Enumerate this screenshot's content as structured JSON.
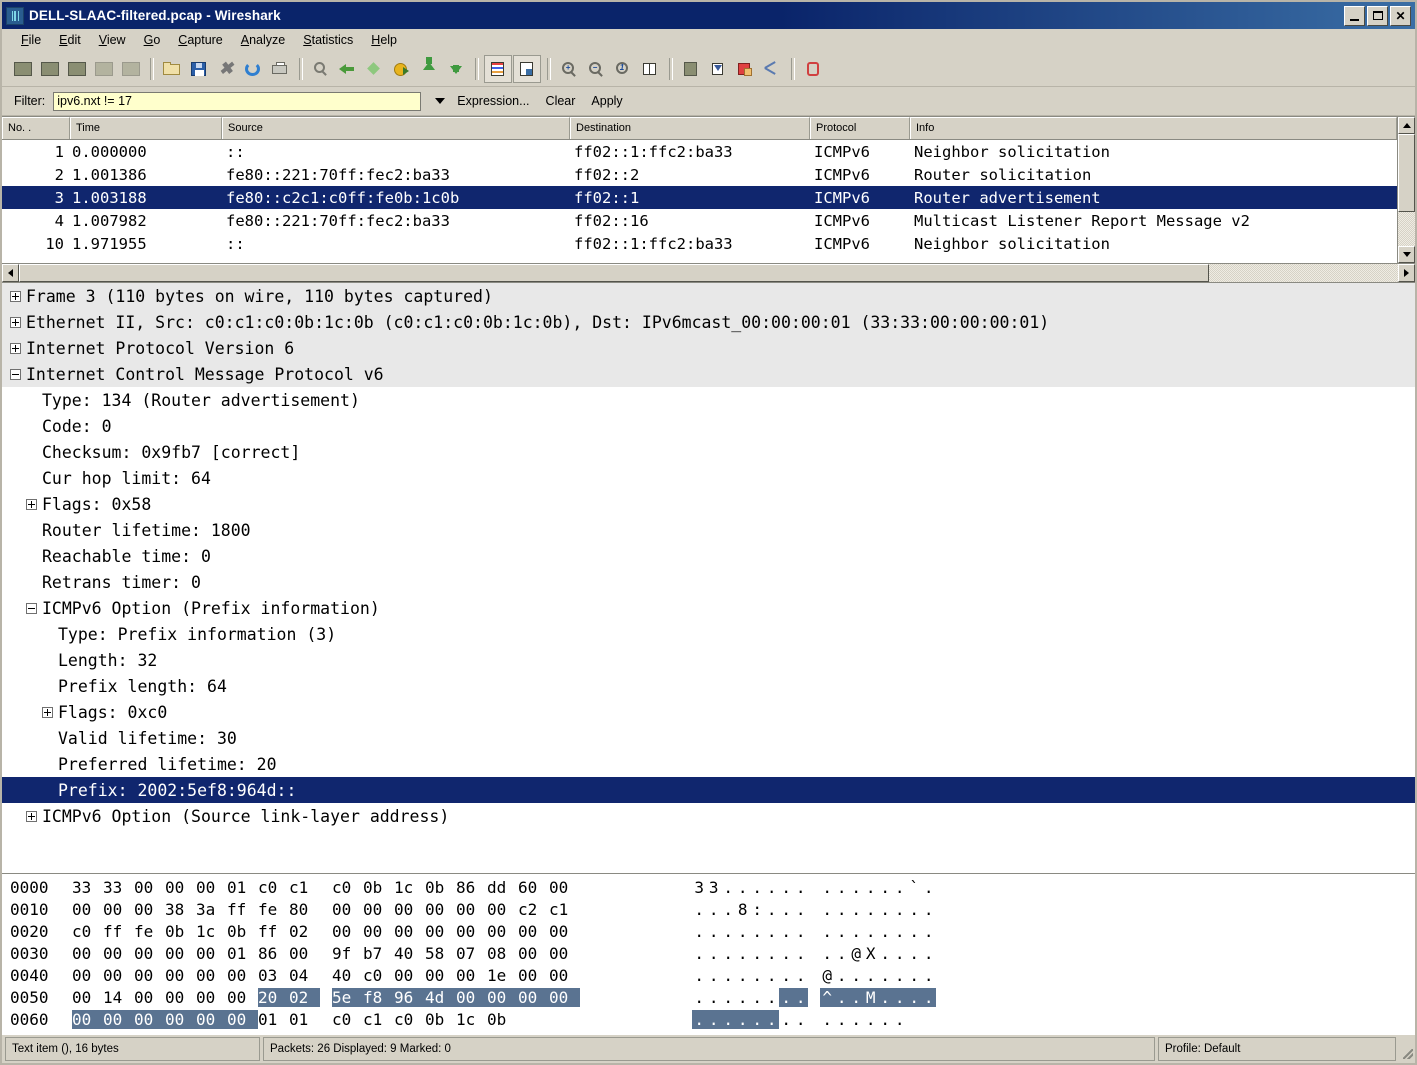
{
  "window": {
    "title": "DELL-SLAAC-filtered.pcap - Wireshark",
    "app_icon": "wireshark-icon",
    "minimize_label": "_",
    "maximize_label": "□",
    "close_label": "✕"
  },
  "menubar": {
    "items": [
      {
        "label": "File",
        "mnemonic": "F"
      },
      {
        "label": "Edit",
        "mnemonic": "E"
      },
      {
        "label": "View",
        "mnemonic": "V"
      },
      {
        "label": "Go",
        "mnemonic": "G"
      },
      {
        "label": "Capture",
        "mnemonic": "C"
      },
      {
        "label": "Analyze",
        "mnemonic": "A"
      },
      {
        "label": "Statistics",
        "mnemonic": "S"
      },
      {
        "label": "Help",
        "mnemonic": "H"
      }
    ]
  },
  "toolbar": {
    "buttons": [
      {
        "name": "list-interfaces-icon"
      },
      {
        "name": "capture-options-icon"
      },
      {
        "name": "start-capture-icon"
      },
      {
        "name": "stop-capture-icon"
      },
      {
        "name": "restart-capture-icon"
      },
      {
        "name": "separator"
      },
      {
        "name": "open-file-icon"
      },
      {
        "name": "save-file-icon"
      },
      {
        "name": "close-file-icon"
      },
      {
        "name": "reload-file-icon"
      },
      {
        "name": "print-icon"
      },
      {
        "name": "separator"
      },
      {
        "name": "find-packet-icon"
      },
      {
        "name": "go-back-icon"
      },
      {
        "name": "go-forward-icon"
      },
      {
        "name": "go-to-packet-icon"
      },
      {
        "name": "go-to-first-packet-icon"
      },
      {
        "name": "go-to-last-packet-icon"
      },
      {
        "name": "separator"
      },
      {
        "name": "colorize-packet-list-icon"
      },
      {
        "name": "auto-scroll-live-capture-icon"
      },
      {
        "name": "separator"
      },
      {
        "name": "zoom-in-icon"
      },
      {
        "name": "zoom-out-icon"
      },
      {
        "name": "normal-size-icon"
      },
      {
        "name": "resize-columns-icon"
      },
      {
        "name": "separator"
      },
      {
        "name": "capture-filters-icon"
      },
      {
        "name": "display-filters-icon"
      },
      {
        "name": "coloring-rules-icon"
      },
      {
        "name": "preferences-icon"
      },
      {
        "name": "separator"
      },
      {
        "name": "help-contents-icon"
      }
    ]
  },
  "filter_bar": {
    "label": "Filter:",
    "value": "ipv6.nxt != 17",
    "placeholder": "",
    "dropdown_icon": "chevron-down-icon",
    "expression_label": "Expression...",
    "clear_label": "Clear",
    "apply_label": "Apply"
  },
  "packet_list": {
    "columns": [
      {
        "label": "No. .",
        "key": "no"
      },
      {
        "label": "Time",
        "key": "time"
      },
      {
        "label": "Source",
        "key": "source"
      },
      {
        "label": "Destination",
        "key": "destination"
      },
      {
        "label": "Protocol",
        "key": "protocol"
      },
      {
        "label": "Info",
        "key": "info"
      }
    ],
    "rows": [
      {
        "no": "1",
        "time": "0.000000",
        "source": "::",
        "destination": "ff02::1:ffc2:ba33",
        "protocol": "ICMPv6",
        "info": "Neighbor solicitation",
        "selected": false
      },
      {
        "no": "2",
        "time": "1.001386",
        "source": "fe80::221:70ff:fec2:ba33",
        "destination": "ff02::2",
        "protocol": "ICMPv6",
        "info": "Router solicitation",
        "selected": false
      },
      {
        "no": "3",
        "time": "1.003188",
        "source": "fe80::c2c1:c0ff:fe0b:1c0b",
        "destination": "ff02::1",
        "protocol": "ICMPv6",
        "info": "Router advertisement",
        "selected": true
      },
      {
        "no": "4",
        "time": "1.007982",
        "source": "fe80::221:70ff:fec2:ba33",
        "destination": "ff02::16",
        "protocol": "ICMPv6",
        "info": "Multicast Listener Report Message v2",
        "selected": false
      },
      {
        "no": "10",
        "time": "1.971955",
        "source": "::",
        "destination": "ff02::1:ffc2:ba33",
        "protocol": "ICMPv6",
        "info": "Neighbor solicitation",
        "selected": false
      }
    ]
  },
  "packet_detail": {
    "rows": [
      {
        "text": "Frame 3 (110 bytes on wire, 110 bytes captured)",
        "indent": 0,
        "toggle": "plus",
        "protocol": true,
        "selected": false
      },
      {
        "text": "Ethernet II, Src: c0:c1:c0:0b:1c:0b (c0:c1:c0:0b:1c:0b), Dst: IPv6mcast_00:00:00:01 (33:33:00:00:00:01)",
        "indent": 0,
        "toggle": "plus",
        "protocol": true,
        "selected": false
      },
      {
        "text": "Internet Protocol Version 6",
        "indent": 0,
        "toggle": "plus",
        "protocol": true,
        "selected": false
      },
      {
        "text": "Internet Control Message Protocol v6",
        "indent": 0,
        "toggle": "minus",
        "protocol": true,
        "selected": false
      },
      {
        "text": "Type: 134 (Router advertisement)",
        "indent": 1,
        "toggle": "none",
        "protocol": false,
        "selected": false
      },
      {
        "text": "Code: 0",
        "indent": 1,
        "toggle": "none",
        "protocol": false,
        "selected": false
      },
      {
        "text": "Checksum: 0x9fb7 [correct]",
        "indent": 1,
        "toggle": "none",
        "protocol": false,
        "selected": false
      },
      {
        "text": "Cur hop limit: 64",
        "indent": 1,
        "toggle": "none",
        "protocol": false,
        "selected": false
      },
      {
        "text": "Flags: 0x58",
        "indent": 1,
        "toggle": "plus",
        "protocol": false,
        "selected": false
      },
      {
        "text": "Router lifetime: 1800",
        "indent": 1,
        "toggle": "none",
        "protocol": false,
        "selected": false
      },
      {
        "text": "Reachable time: 0",
        "indent": 1,
        "toggle": "none",
        "protocol": false,
        "selected": false
      },
      {
        "text": "Retrans timer: 0",
        "indent": 1,
        "toggle": "none",
        "protocol": false,
        "selected": false
      },
      {
        "text": "ICMPv6 Option (Prefix information)",
        "indent": 1,
        "toggle": "minus",
        "protocol": false,
        "selected": false
      },
      {
        "text": "Type: Prefix information (3)",
        "indent": 2,
        "toggle": "none",
        "protocol": false,
        "selected": false
      },
      {
        "text": "Length: 32",
        "indent": 2,
        "toggle": "none",
        "protocol": false,
        "selected": false
      },
      {
        "text": "Prefix length: 64",
        "indent": 2,
        "toggle": "none",
        "protocol": false,
        "selected": false
      },
      {
        "text": "Flags: 0xc0",
        "indent": 2,
        "toggle": "plus",
        "protocol": false,
        "selected": false
      },
      {
        "text": "Valid lifetime: 30",
        "indent": 2,
        "toggle": "none",
        "protocol": false,
        "selected": false
      },
      {
        "text": "Preferred lifetime: 20",
        "indent": 2,
        "toggle": "none",
        "protocol": false,
        "selected": false
      },
      {
        "text": "Prefix: 2002:5ef8:964d::",
        "indent": 2,
        "toggle": "none",
        "protocol": false,
        "selected": true
      },
      {
        "text": "ICMPv6 Option (Source link-layer address)",
        "indent": 1,
        "toggle": "plus",
        "protocol": false,
        "selected": false
      }
    ]
  },
  "hex_dump": {
    "rows": [
      {
        "offset": "0000",
        "bytes": [
          "33",
          "33",
          "00",
          "00",
          "00",
          "01",
          "c0",
          "c1",
          "c0",
          "0b",
          "1c",
          "0b",
          "86",
          "dd",
          "60",
          "00"
        ],
        "ascii": [
          "3",
          "3",
          ".",
          ".",
          ".",
          ".",
          ".",
          ".",
          ".",
          ".",
          ".",
          ".",
          ".",
          ".",
          "`",
          "."
        ],
        "highlight": []
      },
      {
        "offset": "0010",
        "bytes": [
          "00",
          "00",
          "00",
          "38",
          "3a",
          "ff",
          "fe",
          "80",
          "00",
          "00",
          "00",
          "00",
          "00",
          "00",
          "c2",
          "c1"
        ],
        "ascii": [
          ".",
          ".",
          ".",
          "8",
          ":",
          ".",
          ".",
          ".",
          ".",
          ".",
          ".",
          ".",
          ".",
          ".",
          ".",
          "."
        ],
        "highlight": []
      },
      {
        "offset": "0020",
        "bytes": [
          "c0",
          "ff",
          "fe",
          "0b",
          "1c",
          "0b",
          "ff",
          "02",
          "00",
          "00",
          "00",
          "00",
          "00",
          "00",
          "00",
          "00"
        ],
        "ascii": [
          ".",
          ".",
          ".",
          ".",
          ".",
          ".",
          ".",
          ".",
          ".",
          ".",
          ".",
          ".",
          ".",
          ".",
          ".",
          "."
        ],
        "highlight": []
      },
      {
        "offset": "0030",
        "bytes": [
          "00",
          "00",
          "00",
          "00",
          "00",
          "01",
          "86",
          "00",
          "9f",
          "b7",
          "40",
          "58",
          "07",
          "08",
          "00",
          "00"
        ],
        "ascii": [
          ".",
          ".",
          ".",
          ".",
          ".",
          ".",
          ".",
          ".",
          ".",
          ".",
          "@",
          "X",
          ".",
          ".",
          ".",
          "."
        ],
        "highlight": []
      },
      {
        "offset": "0040",
        "bytes": [
          "00",
          "00",
          "00",
          "00",
          "00",
          "00",
          "03",
          "04",
          "40",
          "c0",
          "00",
          "00",
          "00",
          "1e",
          "00",
          "00"
        ],
        "ascii": [
          ".",
          ".",
          ".",
          ".",
          ".",
          ".",
          ".",
          ".",
          "@",
          ".",
          ".",
          ".",
          ".",
          ".",
          ".",
          "."
        ],
        "highlight": []
      },
      {
        "offset": "0050",
        "bytes": [
          "00",
          "14",
          "00",
          "00",
          "00",
          "00",
          "20",
          "02",
          "5e",
          "f8",
          "96",
          "4d",
          "00",
          "00",
          "00",
          "00"
        ],
        "ascii": [
          ".",
          ".",
          ".",
          ".",
          ".",
          ".",
          ".",
          ".",
          "^",
          ".",
          ".",
          "M",
          ".",
          ".",
          ".",
          "."
        ],
        "highlight": [
          6,
          7,
          8,
          9,
          10,
          11,
          12,
          13,
          14,
          15
        ]
      },
      {
        "offset": "0060",
        "bytes": [
          "00",
          "00",
          "00",
          "00",
          "00",
          "00",
          "01",
          "01",
          "c0",
          "c1",
          "c0",
          "0b",
          "1c",
          "0b"
        ],
        "ascii": [
          ".",
          ".",
          ".",
          ".",
          ".",
          ".",
          ".",
          ".",
          ".",
          ".",
          ".",
          ".",
          ".",
          "."
        ],
        "highlight": [
          0,
          1,
          2,
          3,
          4,
          5
        ]
      }
    ]
  },
  "status_bar": {
    "left": "Text item (), 16 bytes",
    "middle": "Packets: 26 Displayed: 9 Marked: 0",
    "right": "Profile: Default"
  },
  "colors": {
    "selection_blue": "#10266e",
    "hex_highlight": "#5a7391",
    "filter_field_bg": "#ffffcc",
    "chrome": "#d6d2c6",
    "titlebar_start": "#0a246a",
    "titlebar_end": "#3a6ea5",
    "protocol_row_bg": "#e8e8e8"
  }
}
